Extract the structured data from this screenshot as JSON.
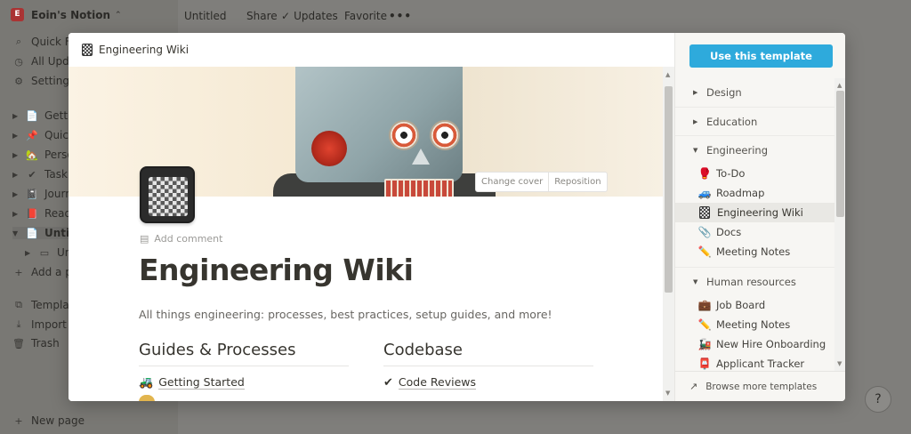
{
  "workspace": {
    "name": "Eoin's Notion"
  },
  "sidebar": {
    "quick_find": "Quick Find",
    "all_updates": "All Updates",
    "settings": "Settings",
    "pages": [
      {
        "label": "Getting Started",
        "icon": "📄"
      },
      {
        "label": "Quick Note",
        "icon": "📌"
      },
      {
        "label": "Personal Home",
        "icon": "🏡"
      },
      {
        "label": "Task List",
        "icon": "✔"
      },
      {
        "label": "Journal",
        "icon": "📓"
      },
      {
        "label": "Reading List",
        "icon": "📕"
      },
      {
        "label": "Untitled",
        "icon": "📄"
      }
    ],
    "sub_page": "Untitled",
    "add_page": "Add a page",
    "templates": "Templates",
    "import": "Import",
    "trash": "Trash",
    "new_page": "New page"
  },
  "topbar": {
    "page_title": "Untitled",
    "share": "Share",
    "updates": "Updates",
    "favorite": "Favorite",
    "more": "•••"
  },
  "preview": {
    "header_title": "Engineering Wiki",
    "change_cover": "Change cover",
    "reposition": "Reposition",
    "add_comment": "Add comment",
    "title": "Engineering Wiki",
    "description": "All things engineering: processes, best practices, setup guides, and more!",
    "col1": {
      "heading": "Guides & Processes",
      "item": "Getting Started",
      "item_icon": "🚜"
    },
    "col2": {
      "heading": "Codebase",
      "item": "Code Reviews",
      "item_icon": "✔"
    }
  },
  "templates_panel": {
    "use_button": "Use this template",
    "groups": [
      {
        "label": "Design",
        "expanded": false
      },
      {
        "label": "Education",
        "expanded": false
      },
      {
        "label": "Engineering",
        "expanded": true,
        "items": [
          {
            "label": "To-Do",
            "icon": "🥊"
          },
          {
            "label": "Roadmap",
            "icon": "🚙"
          },
          {
            "label": "Engineering Wiki",
            "icon": "notebook",
            "selected": true
          },
          {
            "label": "Docs",
            "icon": "📎"
          },
          {
            "label": "Meeting Notes",
            "icon": "✏️"
          }
        ]
      },
      {
        "label": "Human resources",
        "expanded": true,
        "items": [
          {
            "label": "Job Board",
            "icon": "💼"
          },
          {
            "label": "Meeting Notes",
            "icon": "✏️"
          },
          {
            "label": "New Hire Onboarding",
            "icon": "🚂"
          },
          {
            "label": "Applicant Tracker",
            "icon": "📮"
          }
        ]
      }
    ],
    "browse_more": "Browse more templates"
  },
  "help": "?",
  "colors": {
    "accent": "#2eaadc",
    "text": "#37352f",
    "panel_bg": "#f7f6f3"
  }
}
